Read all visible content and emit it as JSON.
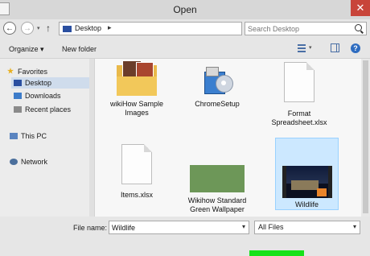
{
  "window": {
    "title": "Open",
    "close_symbol": "✕"
  },
  "nav": {
    "back_symbol": "←",
    "forward_symbol": "→",
    "up_symbol": "↑",
    "dropdown_symbol": "▾",
    "refresh_symbol": "↻",
    "address": "Desktop",
    "address_sep": "▸",
    "search_placeholder": "Search Desktop"
  },
  "toolbar": {
    "organize": "Organize ▾",
    "new_folder": "New folder",
    "help": "?"
  },
  "sidebar": {
    "items": [
      {
        "label": "Favorites"
      },
      {
        "label": "Desktop"
      },
      {
        "label": "Downloads"
      },
      {
        "label": "Recent places"
      },
      {
        "label": "This PC"
      },
      {
        "label": "Network"
      }
    ]
  },
  "files": [
    {
      "name": "wikiHow Sample Images",
      "icon": "folder-icon"
    },
    {
      "name": "ChromeSetup",
      "icon": "installer-icon"
    },
    {
      "name": "Format Spreadsheet.xlsx",
      "icon": "document-icon"
    },
    {
      "name": "Items.xlsx",
      "icon": "document-icon"
    },
    {
      "name": "Wikihow Standard Green Wallpaper",
      "icon": "image-icon"
    },
    {
      "name": "Wildlife",
      "icon": "video-icon"
    }
  ],
  "bottom": {
    "file_name_label": "File name:",
    "file_name_value": "Wildlife",
    "filter_value": "All Files",
    "dropdown_symbol": "▾"
  },
  "colors": {
    "selection": "#cce8ff",
    "green_wallpaper": "#6d9758",
    "highlight": "#18e21a"
  }
}
